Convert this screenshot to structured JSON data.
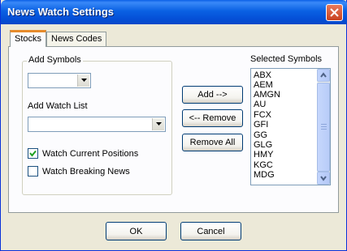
{
  "window": {
    "title": "News Watch Settings",
    "accent_color": "#0A5FE6"
  },
  "tabs": [
    {
      "label": "Stocks",
      "active": true
    },
    {
      "label": "News Codes",
      "active": false
    }
  ],
  "add_symbols": {
    "group_label": "Add Symbols",
    "symbol_combo_value": "",
    "watch_list_label": "Add Watch List",
    "watch_list_value": ""
  },
  "options": {
    "watch_current_positions": {
      "label": "Watch Current Positions",
      "checked": true
    },
    "watch_breaking_news": {
      "label": "Watch Breaking News",
      "checked": false
    }
  },
  "actions": {
    "add_label": "Add -->",
    "remove_label": "<-- Remove",
    "remove_all_label": "Remove All"
  },
  "selected_symbols": {
    "label": "Selected Symbols",
    "items": [
      "ABX",
      "AEM",
      "AMGN",
      "AU",
      "FCX",
      "GFI",
      "GG",
      "GLG",
      "HMY",
      "KGC",
      "MDG"
    ]
  },
  "footer": {
    "ok_label": "OK",
    "cancel_label": "Cancel"
  }
}
